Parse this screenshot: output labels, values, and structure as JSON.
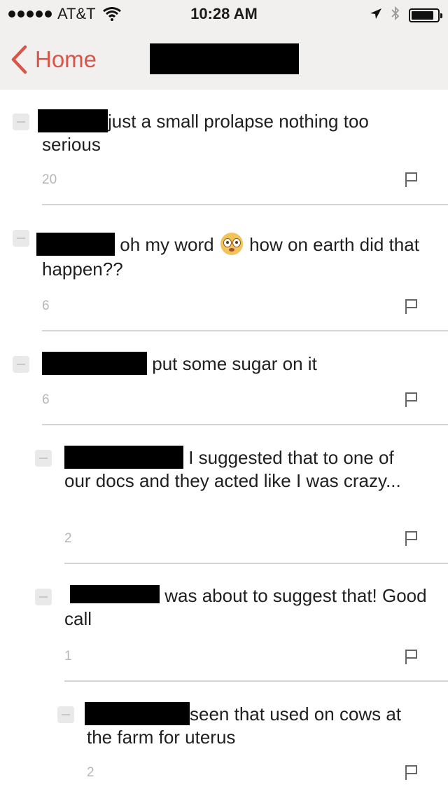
{
  "status_bar": {
    "carrier": "AT&T",
    "time": "10:28 AM",
    "signal_icon": "signal-dots-icon",
    "wifi_icon": "wifi-icon",
    "location_icon": "location-arrow-icon",
    "bluetooth_icon": "bluetooth-icon",
    "battery_icon": "battery-icon",
    "battery_level": 0.85
  },
  "nav": {
    "back_label": "Home",
    "back_icon": "chevron-left-icon",
    "accent_color": "#d6564a"
  },
  "comments": [
    {
      "text": "just a small prolapse nothing too serious",
      "score": "20"
    },
    {
      "text_before_emoji": "oh my word",
      "emoji": "flushed-face-emoji",
      "text_after_emoji": "how on earth did that happen??",
      "score": "6"
    },
    {
      "text": "put some sugar on it",
      "score": "6"
    },
    {
      "text": "I suggested that to one of our docs and they acted like I was crazy...",
      "score": "2"
    },
    {
      "text": "was about to suggest that! Good call",
      "score": "1"
    },
    {
      "text": "seen that used on cows at the farm for uterus",
      "score": "2"
    }
  ]
}
